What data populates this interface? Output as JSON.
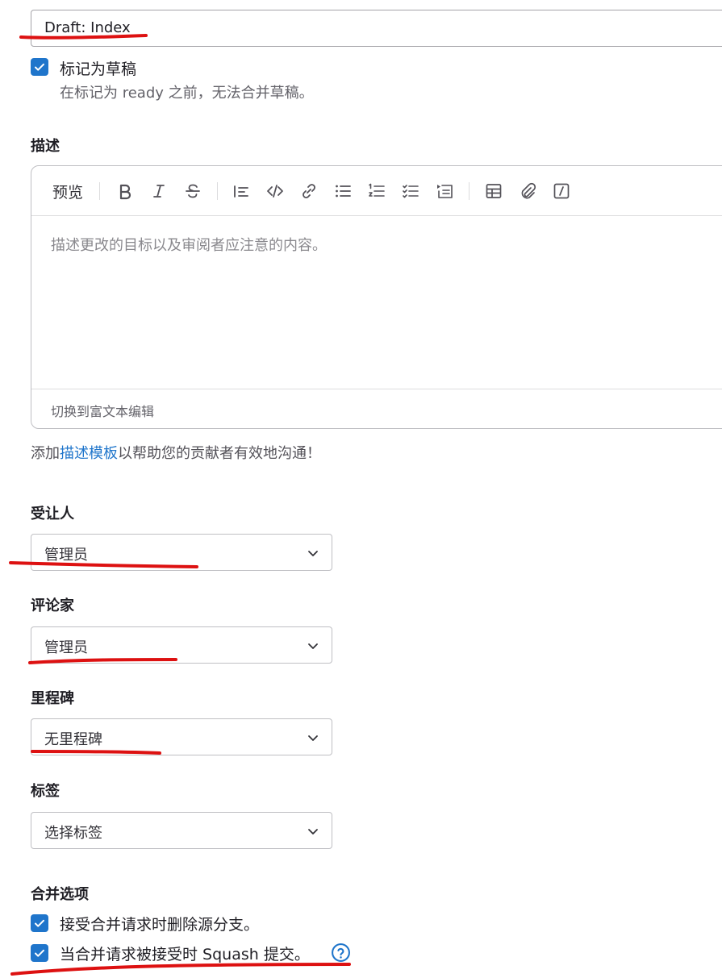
{
  "title_field": {
    "value": "Draft: Index"
  },
  "draft_option": {
    "label": "标记为草稿",
    "help": "在标记为 ready 之前，无法合并草稿。"
  },
  "description": {
    "label": "描述",
    "toolbar": {
      "preview": "预览",
      "buttons": [
        "bold-icon",
        "italic-icon",
        "strikethrough-icon",
        "quote-icon",
        "code-icon",
        "link-icon",
        "bullet-list-icon",
        "numbered-list-icon",
        "task-list-icon",
        "collapsible-icon",
        "table-icon",
        "attach-icon",
        "quick-action-icon"
      ]
    },
    "placeholder": "描述更改的目标以及审阅者应注意的内容。",
    "switch_label": "切换到富文本编辑",
    "template_prefix": "添加",
    "template_link": "描述模板",
    "template_suffix": "以帮助您的贡献者有效地沟通！"
  },
  "assignee": {
    "label": "受让人",
    "value": "管理员"
  },
  "reviewer": {
    "label": "评论家",
    "value": "管理员"
  },
  "milestone": {
    "label": "里程碑",
    "value": "无里程碑"
  },
  "labels": {
    "label": "标签",
    "value": "选择标签"
  },
  "merge_options": {
    "label": "合并选项",
    "delete_source": "接受合并请求时删除源分支。",
    "squash": "当合并请求被接受时 Squash 提交。"
  },
  "colors": {
    "accent": "#1f75cb",
    "annotation": "#dd1111"
  }
}
